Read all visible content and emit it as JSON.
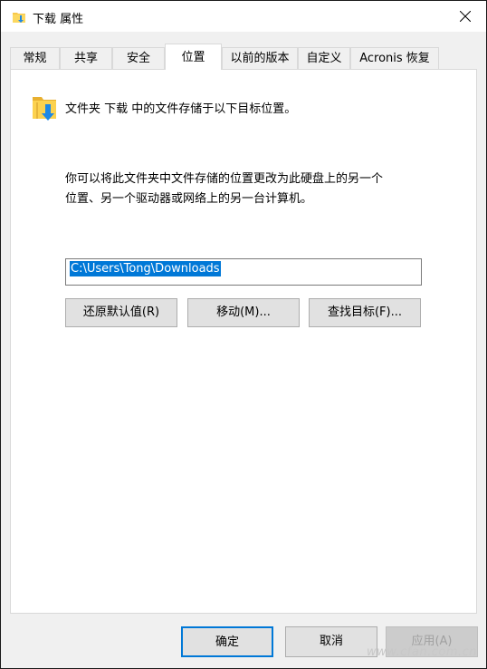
{
  "window": {
    "title": "下载 属性",
    "close_icon": "close-icon"
  },
  "tabs": [
    {
      "label": "常规",
      "active": false
    },
    {
      "label": "共享",
      "active": false
    },
    {
      "label": "安全",
      "active": false
    },
    {
      "label": "位置",
      "active": true
    },
    {
      "label": "以前的版本",
      "active": false
    },
    {
      "label": "自定义",
      "active": false
    },
    {
      "label": "Acronis 恢复",
      "active": false
    }
  ],
  "location": {
    "header": "文件夹 下载 中的文件存储于以下目标位置。",
    "description_line1": "你可以将此文件夹中文件存储的位置更改为此硬盘上的另一个",
    "description_line2": "位置、另一个驱动器或网络上的另一台计算机。",
    "path_value": "C:\\Users\\Tong\\Downloads",
    "restore_label": "还原默认值(R)",
    "move_label": "移动(M)...",
    "find_target_label": "查找目标(F)..."
  },
  "footer": {
    "ok_label": "确定",
    "cancel_label": "取消",
    "apply_label": "应用(A)"
  },
  "watermark": "www.cfan.com.cn",
  "colors": {
    "accent": "#0078d7",
    "folder_yellow": "#f8c84a",
    "arrow_blue": "#1e88e5"
  }
}
